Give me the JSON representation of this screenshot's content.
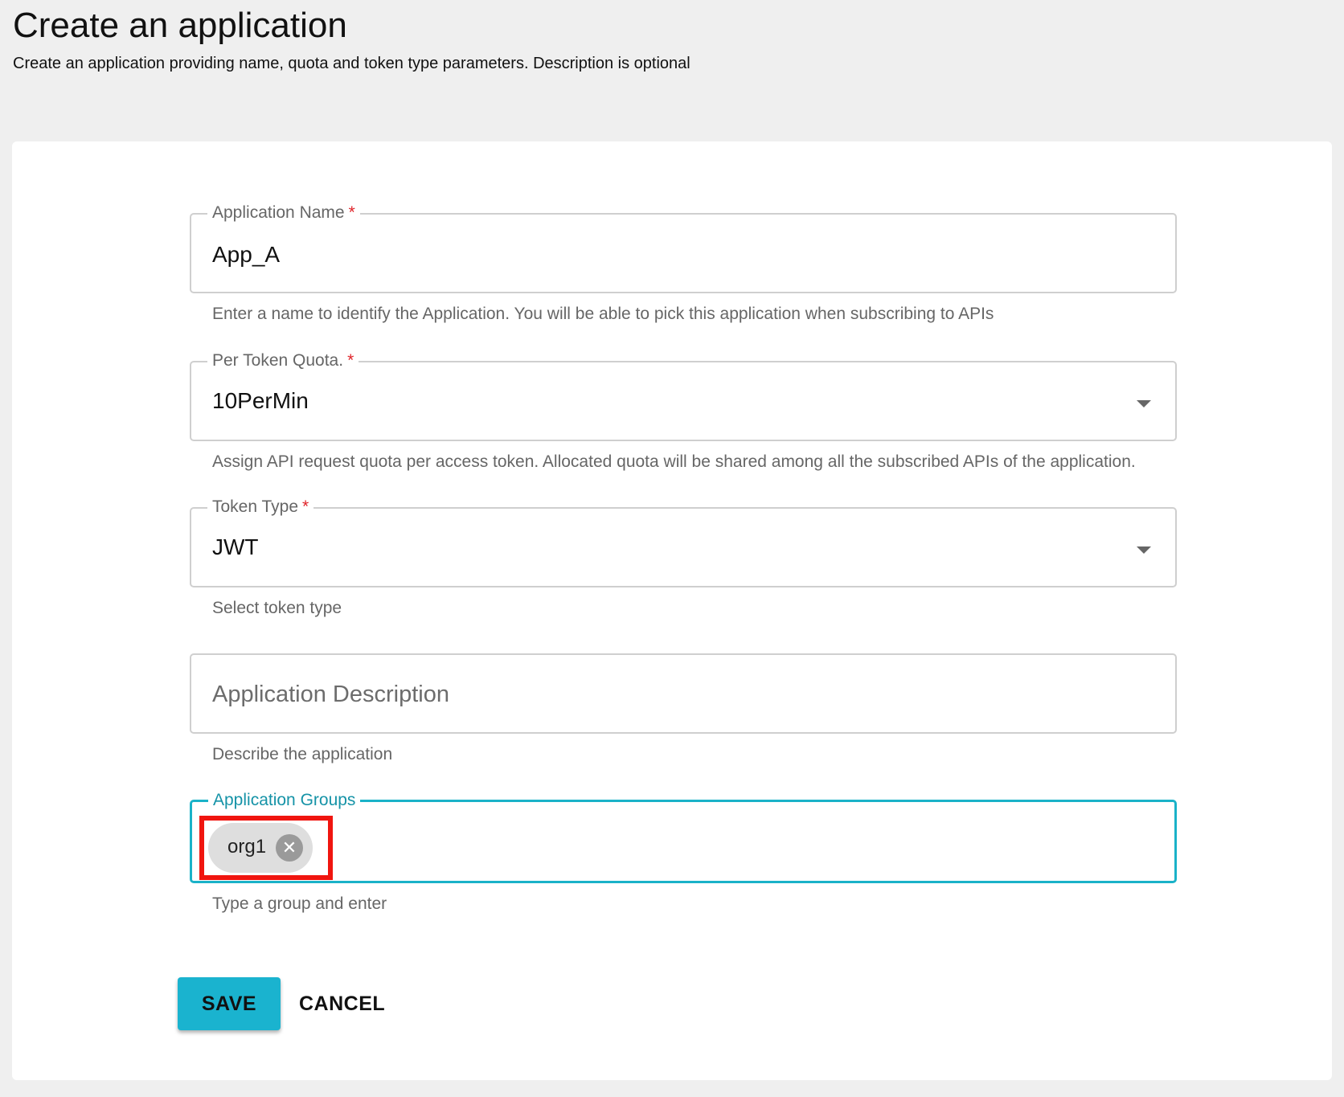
{
  "header": {
    "title": "Create an application",
    "subtitle": "Create an application providing name, quota and token type parameters. Description is optional"
  },
  "form": {
    "application_name": {
      "label": "Application Name",
      "required_mark": "*",
      "value": "App_A",
      "helper": "Enter a name to identify the Application. You will be able to pick this application when subscribing to APIs"
    },
    "per_token_quota": {
      "label": "Per Token Quota.",
      "required_mark": "*",
      "value": "10PerMin",
      "helper": "Assign API request quota per access token. Allocated quota will be shared among all the subscribed APIs of the application."
    },
    "token_type": {
      "label": "Token Type",
      "required_mark": "*",
      "value": "JWT",
      "helper": "Select token type"
    },
    "application_description": {
      "placeholder": "Application Description",
      "value": "",
      "helper": "Describe the application"
    },
    "application_groups": {
      "label": "Application Groups",
      "chips": [
        "org1"
      ],
      "helper": "Type a group and enter"
    }
  },
  "actions": {
    "save_label": "SAVE",
    "cancel_label": "CANCEL"
  },
  "colors": {
    "accent": "#1ab3cf",
    "focused_border": "#1ab2c8",
    "required": "#e0242a",
    "highlight": "#f0150f",
    "page_background": "#efefef"
  },
  "icons": {
    "dropdown": "caret-down-icon",
    "chip_delete": "close-circle-icon"
  }
}
